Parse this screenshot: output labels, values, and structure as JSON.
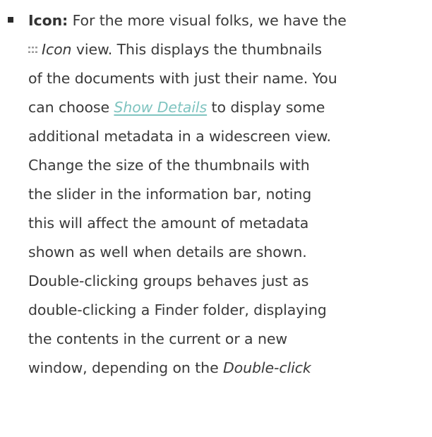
{
  "list_item": {
    "term": "Icon:",
    "line1_rest": " For the more visual folks, we have the",
    "icon_name": "grid-view-icon",
    "view_name": "Icon",
    "line2_rest": " view. This displays the thumbnails",
    "line3": "of the documents with just their name. You",
    "line4_pre": "can choose ",
    "show_details_link": "Show Details",
    "line4_post": " to display some",
    "line5": "additional metadata in a widescreen view.",
    "line6": "Change the size of the thumbnails with",
    "line7": "the slider in the information bar, noting",
    "line8": "this will affect the amount of metadata",
    "line9": "shown as well when details are shown.",
    "line10": "Double-clicking groups behaves just as",
    "line11": "double-clicking a Finder folder, displaying",
    "line12": "the contents in the current or a new",
    "line13_pre": "window, depending on the ",
    "double_click_term": "Double-click"
  },
  "colors": {
    "text": "#3a3a3a",
    "link": "#7fc4c0",
    "bullet": "#2b2b2b"
  }
}
